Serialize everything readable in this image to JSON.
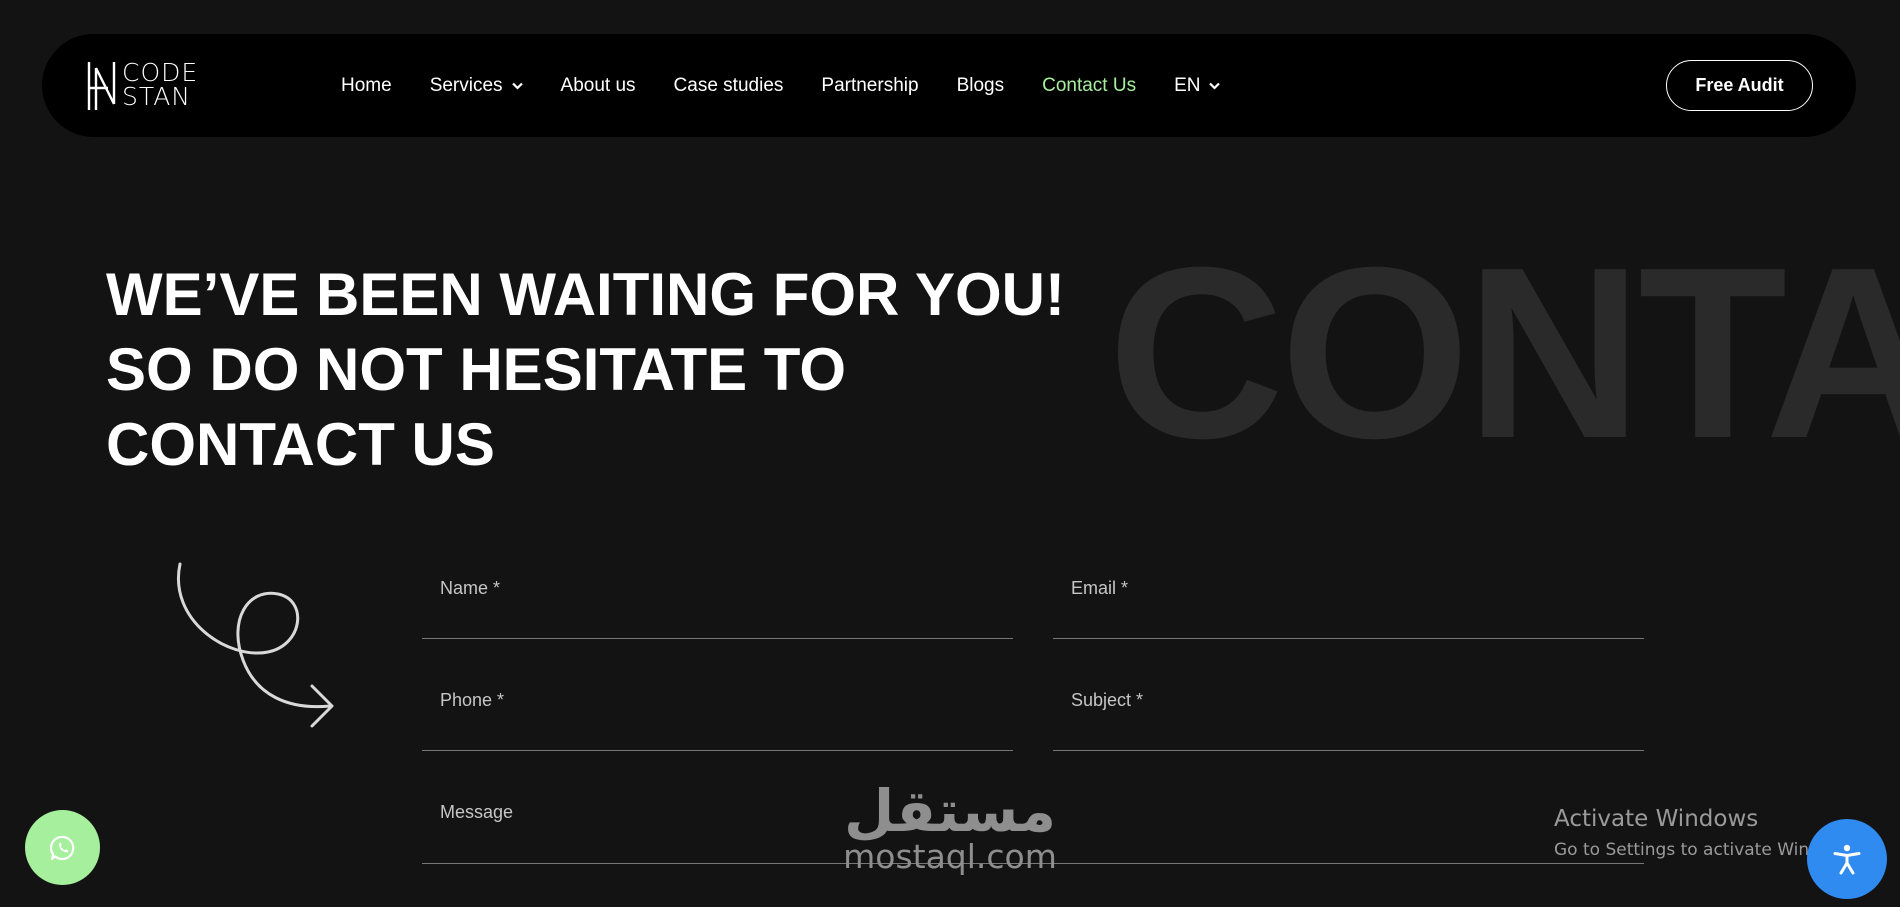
{
  "brand": {
    "logo_line1": "CODE",
    "logo_line2": "STAN"
  },
  "nav": {
    "items": [
      {
        "label": "Home"
      },
      {
        "label": "Services"
      },
      {
        "label": "About us"
      },
      {
        "label": "Case studies"
      },
      {
        "label": "Partnership"
      },
      {
        "label": "Blogs"
      },
      {
        "label": "Contact Us"
      },
      {
        "label": "EN"
      }
    ],
    "cta_label": "Free Audit",
    "active_color": "#a5ef9d"
  },
  "hero": {
    "background_word": "CONTA",
    "headline_lines": [
      "WE’VE BEEN WAITING FOR YOU!",
      "SO DO NOT HESITATE TO",
      "CONTACT US"
    ]
  },
  "form": {
    "name_label": "Name *",
    "email_label": "Email *",
    "phone_label": "Phone *",
    "subject_label": "Subject *",
    "message_label": "Message"
  },
  "floating": {
    "whatsapp_icon": "whatsapp-icon",
    "whatsapp_color": "#a5ef9d",
    "accessibility_icon": "accessibility-icon",
    "accessibility_color": "#2f8bef"
  },
  "system_overlay": {
    "activate_title": "Activate Windows",
    "activate_sub": "Go to Settings to activate Windows."
  },
  "watermark": {
    "arabic": "مستقل",
    "latin": "mostaql.com"
  }
}
